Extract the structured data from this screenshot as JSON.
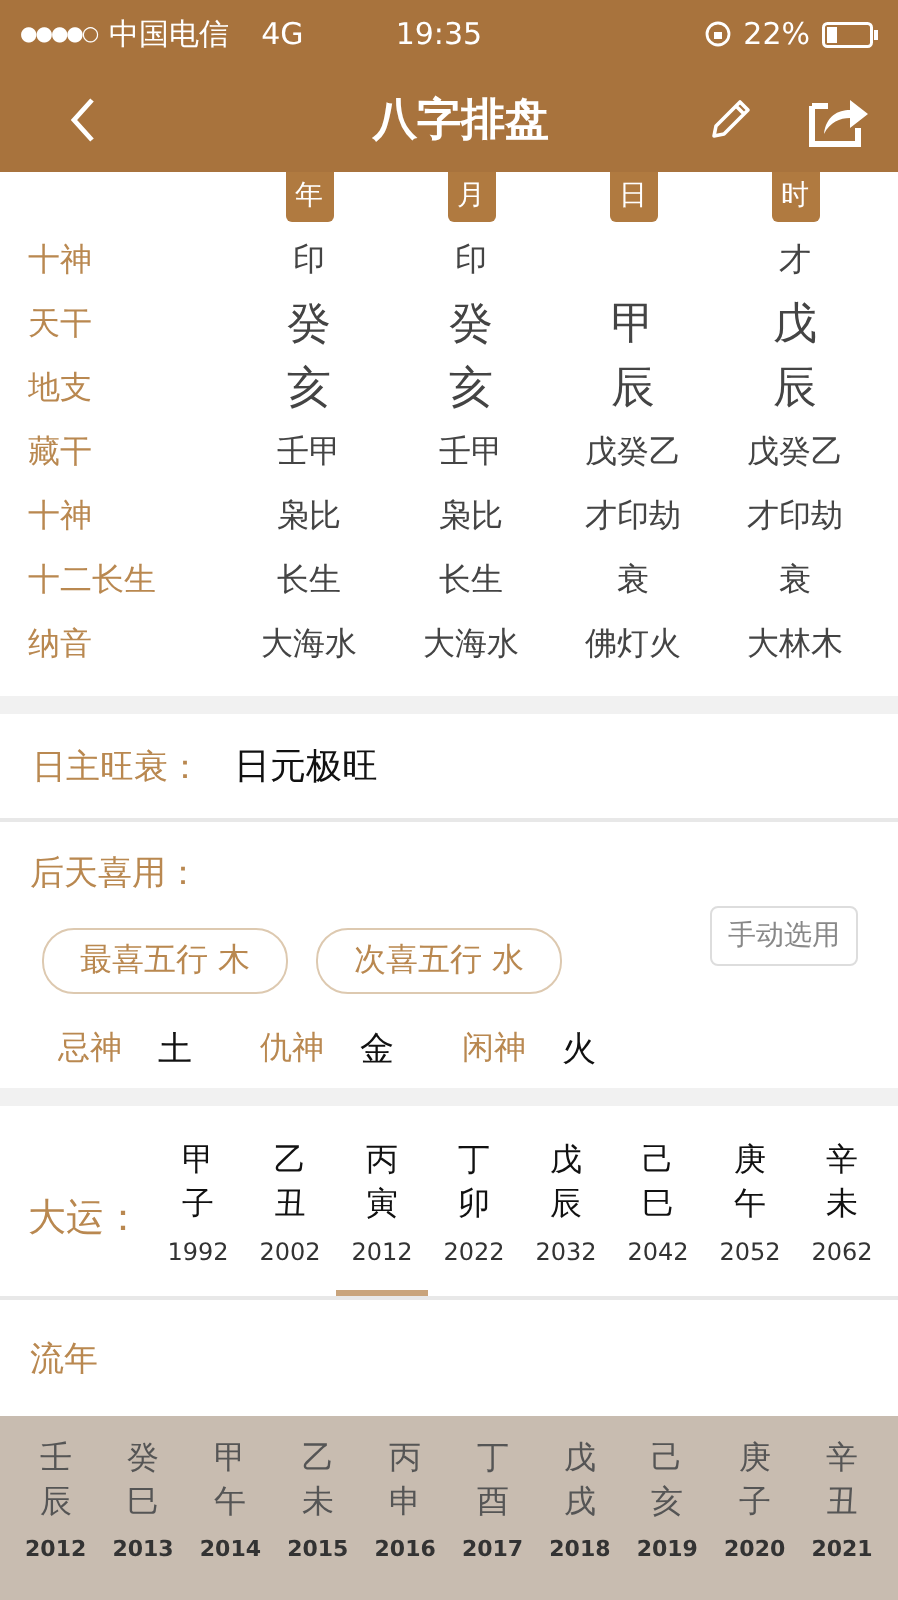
{
  "status_bar": {
    "signal_dots": "●●●●○",
    "carrier": "中国电信",
    "network": "4G",
    "time": "19:35",
    "battery": "22%"
  },
  "nav": {
    "title": "八字排盘"
  },
  "pillars": {
    "columns": [
      "年",
      "月",
      "日",
      "时"
    ],
    "rows": [
      {
        "label": "十神",
        "kind": "small",
        "values": [
          {
            "text": "印"
          },
          {
            "text": "印"
          },
          {
            "kind": "empty"
          },
          {
            "text": "才"
          }
        ]
      },
      {
        "label": "天干",
        "kind": "large",
        "values": [
          {
            "text": "癸"
          },
          {
            "text": "癸"
          },
          {
            "text": "甲"
          },
          {
            "text": "戊"
          }
        ]
      },
      {
        "label": "地支",
        "kind": "large",
        "values": [
          {
            "text": "亥"
          },
          {
            "text": "亥"
          },
          {
            "text": "辰"
          },
          {
            "text": "辰"
          }
        ]
      },
      {
        "label": "藏干",
        "kind": "small",
        "values": [
          {
            "text": "壬甲"
          },
          {
            "text": "壬甲"
          },
          {
            "text": "戊癸乙"
          },
          {
            "text": "戊癸乙"
          }
        ]
      },
      {
        "label": "十神",
        "kind": "small",
        "values": [
          {
            "text": "枭比"
          },
          {
            "text": "枭比"
          },
          {
            "text": "才印劫"
          },
          {
            "text": "才印劫"
          }
        ]
      },
      {
        "label": "十二长生",
        "kind": "small",
        "values": [
          {
            "text": "长生"
          },
          {
            "text": "长生"
          },
          {
            "text": "衰"
          },
          {
            "text": "衰"
          }
        ]
      },
      {
        "label": "纳音",
        "kind": "small",
        "values": [
          {
            "text": "大海水"
          },
          {
            "text": "大海水"
          },
          {
            "text": "佛灯火"
          },
          {
            "text": "大林木"
          }
        ]
      }
    ]
  },
  "strength": {
    "label": "日主旺衰：",
    "value": "日元极旺"
  },
  "favorable": {
    "label": "后天喜用：",
    "manual_button": "手动选用",
    "chips": [
      "最喜五行 木",
      "次喜五行 水"
    ],
    "gods": [
      {
        "label": "忌神",
        "value": "土"
      },
      {
        "label": "仇神",
        "value": "金"
      },
      {
        "label": "闲神",
        "value": "火"
      }
    ]
  },
  "dayun": {
    "label": "大运：",
    "items": [
      {
        "stem": "甲",
        "branch": "子",
        "year": "1992",
        "selected": false
      },
      {
        "stem": "乙",
        "branch": "丑",
        "year": "2002",
        "selected": false
      },
      {
        "stem": "丙",
        "branch": "寅",
        "year": "2012",
        "selected": true
      },
      {
        "stem": "丁",
        "branch": "卯",
        "year": "2022",
        "selected": false
      },
      {
        "stem": "戊",
        "branch": "辰",
        "year": "2032",
        "selected": false
      },
      {
        "stem": "己",
        "branch": "巳",
        "year": "2042",
        "selected": false
      },
      {
        "stem": "庚",
        "branch": "午",
        "year": "2052",
        "selected": false
      },
      {
        "stem": "辛",
        "branch": "未",
        "year": "2062",
        "selected": false
      }
    ]
  },
  "liunian": {
    "label": "流年",
    "items": [
      {
        "stem": "壬",
        "branch": "辰",
        "year": "2012"
      },
      {
        "stem": "癸",
        "branch": "巳",
        "year": "2013"
      },
      {
        "stem": "甲",
        "branch": "午",
        "year": "2014"
      },
      {
        "stem": "乙",
        "branch": "未",
        "year": "2015"
      },
      {
        "stem": "丙",
        "branch": "申",
        "year": "2016"
      },
      {
        "stem": "丁",
        "branch": "酉",
        "year": "2017"
      },
      {
        "stem": "戊",
        "branch": "戌",
        "year": "2018"
      },
      {
        "stem": "己",
        "branch": "亥",
        "year": "2019"
      },
      {
        "stem": "庚",
        "branch": "子",
        "year": "2020"
      },
      {
        "stem": "辛",
        "branch": "丑",
        "year": "2021"
      }
    ]
  }
}
